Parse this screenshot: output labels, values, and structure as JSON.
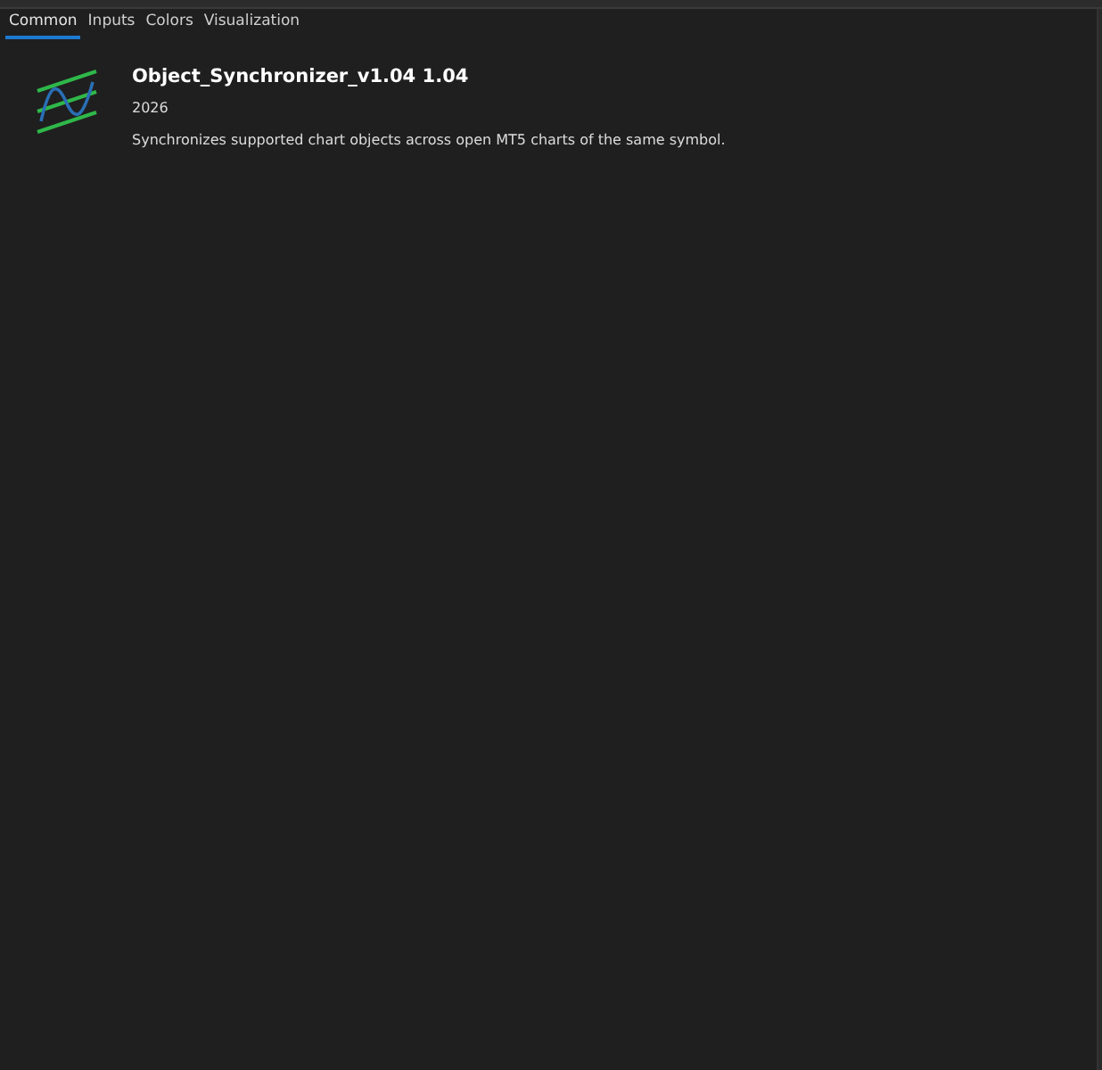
{
  "tabs": [
    {
      "label": "Common",
      "selected": true
    },
    {
      "label": "Inputs",
      "selected": false
    },
    {
      "label": "Colors",
      "selected": false
    },
    {
      "label": "Visualization",
      "selected": false
    }
  ],
  "program": {
    "name": "Object_Synchronizer_v1.04 1.04",
    "copyright": "2026",
    "description": "Synchronizes supported chart objects across open MT5 charts of the same symbol."
  }
}
